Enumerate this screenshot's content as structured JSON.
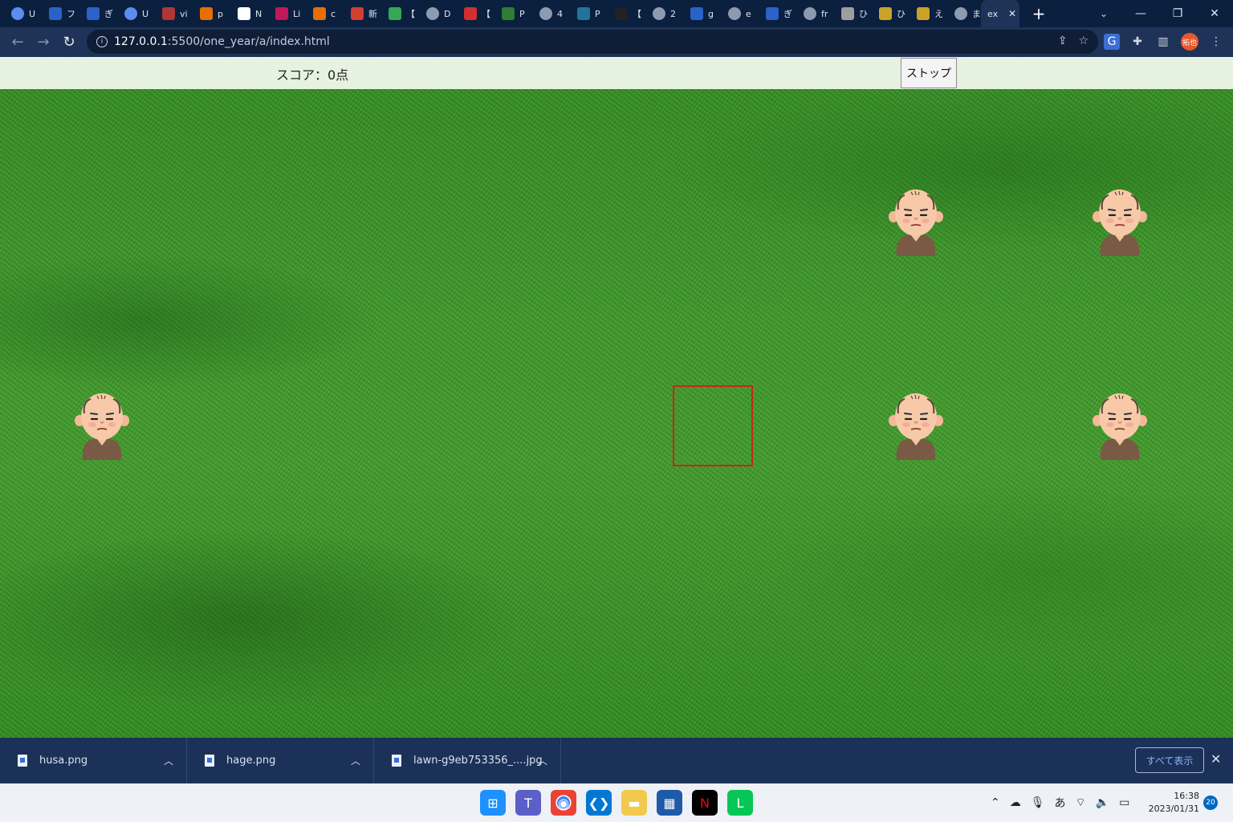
{
  "browser": {
    "tabs": [
      {
        "icon": "globe-icon",
        "label": "U",
        "color": "#5b8def"
      },
      {
        "icon": "search-icon",
        "label": "フ",
        "color": "#2a62c9"
      },
      {
        "icon": "search-icon",
        "label": "ぎ",
        "color": "#2a62c9"
      },
      {
        "icon": "globe-icon",
        "label": "U",
        "color": "#5b8def"
      },
      {
        "icon": "chat-icon",
        "label": "vi",
        "color": "#b03636"
      },
      {
        "icon": "java-icon",
        "label": "p",
        "color": "#e76f00"
      },
      {
        "icon": "notion-icon",
        "label": "N",
        "color": "#ffffff"
      },
      {
        "icon": "logo-icon",
        "label": "Li",
        "color": "#c2185b"
      },
      {
        "icon": "java-icon",
        "label": "c",
        "color": "#e76f00"
      },
      {
        "icon": "calendar-icon",
        "label": "新",
        "color": "#d23f31"
      },
      {
        "icon": "at-icon",
        "label": "【",
        "color": "#34a853"
      },
      {
        "icon": "globe-icon",
        "label": "D",
        "color": "#8e9aaf"
      },
      {
        "icon": "prohibit-icon",
        "label": "【",
        "color": "#d32f2f"
      },
      {
        "icon": "link-icon",
        "label": "P",
        "color": "#2e7d32"
      },
      {
        "icon": "globe-icon",
        "label": "4",
        "color": "#8e9aaf"
      },
      {
        "icon": "wordpress-icon",
        "label": "P",
        "color": "#21759b"
      },
      {
        "icon": "terminal-icon",
        "label": "【",
        "color": "#222222"
      },
      {
        "icon": "globe-icon",
        "label": "2",
        "color": "#8e9aaf"
      },
      {
        "icon": "search-icon",
        "label": "g",
        "color": "#2a62c9"
      },
      {
        "icon": "globe-icon",
        "label": "e",
        "color": "#8e9aaf"
      },
      {
        "icon": "search-icon",
        "label": "ぎ",
        "color": "#2a62c9"
      },
      {
        "icon": "globe-icon",
        "label": "fr",
        "color": "#8e9aaf"
      },
      {
        "icon": "image-icon",
        "label": "ひ",
        "color": "#9e9e9e"
      },
      {
        "icon": "logo-icon",
        "label": "ひ",
        "color": "#c9a227"
      },
      {
        "icon": "logo-icon",
        "label": "え",
        "color": "#c9a227"
      },
      {
        "icon": "globe-icon",
        "label": "ま",
        "color": "#8e9aaf"
      }
    ],
    "active_tab": {
      "icon": "page-icon",
      "label": "ex"
    },
    "new_tab": "+",
    "url_host": "127.0.0.1",
    "url_rest": ":5500/one_year/a/index.html",
    "profile_initials": "拓也"
  },
  "page": {
    "score_label": "スコア：0点",
    "stop_button": "ストップ",
    "characters": [
      {
        "name": "bald-man-1"
      },
      {
        "name": "bald-man-2"
      },
      {
        "name": "bald-man-3"
      },
      {
        "name": "bald-man-4"
      },
      {
        "name": "bald-man-5"
      }
    ],
    "target_color": "#c8261a"
  },
  "downloads": {
    "items": [
      {
        "name": "husa.png"
      },
      {
        "name": "hage.png"
      },
      {
        "name": "lawn-g9eb753356_....jpg"
      }
    ],
    "show_all": "すべて表示"
  },
  "taskbar": {
    "apps": [
      {
        "icon": "windows-start-icon",
        "color": "#1e90ff"
      },
      {
        "icon": "teams-icon",
        "color": "#5b5fc7"
      },
      {
        "icon": "chrome-icon",
        "color": "#ffffff"
      },
      {
        "icon": "vscode-icon",
        "color": "#0078d4"
      },
      {
        "icon": "folder-icon",
        "color": "#f2c94c"
      },
      {
        "icon": "store-icon",
        "color": "#1e5aa8"
      },
      {
        "icon": "netflix-icon",
        "color": "#000000"
      },
      {
        "icon": "line-icon",
        "color": "#06c755"
      }
    ],
    "ime": "あ",
    "time": "16:38",
    "date": "2023/01/31",
    "notifications": "20"
  }
}
